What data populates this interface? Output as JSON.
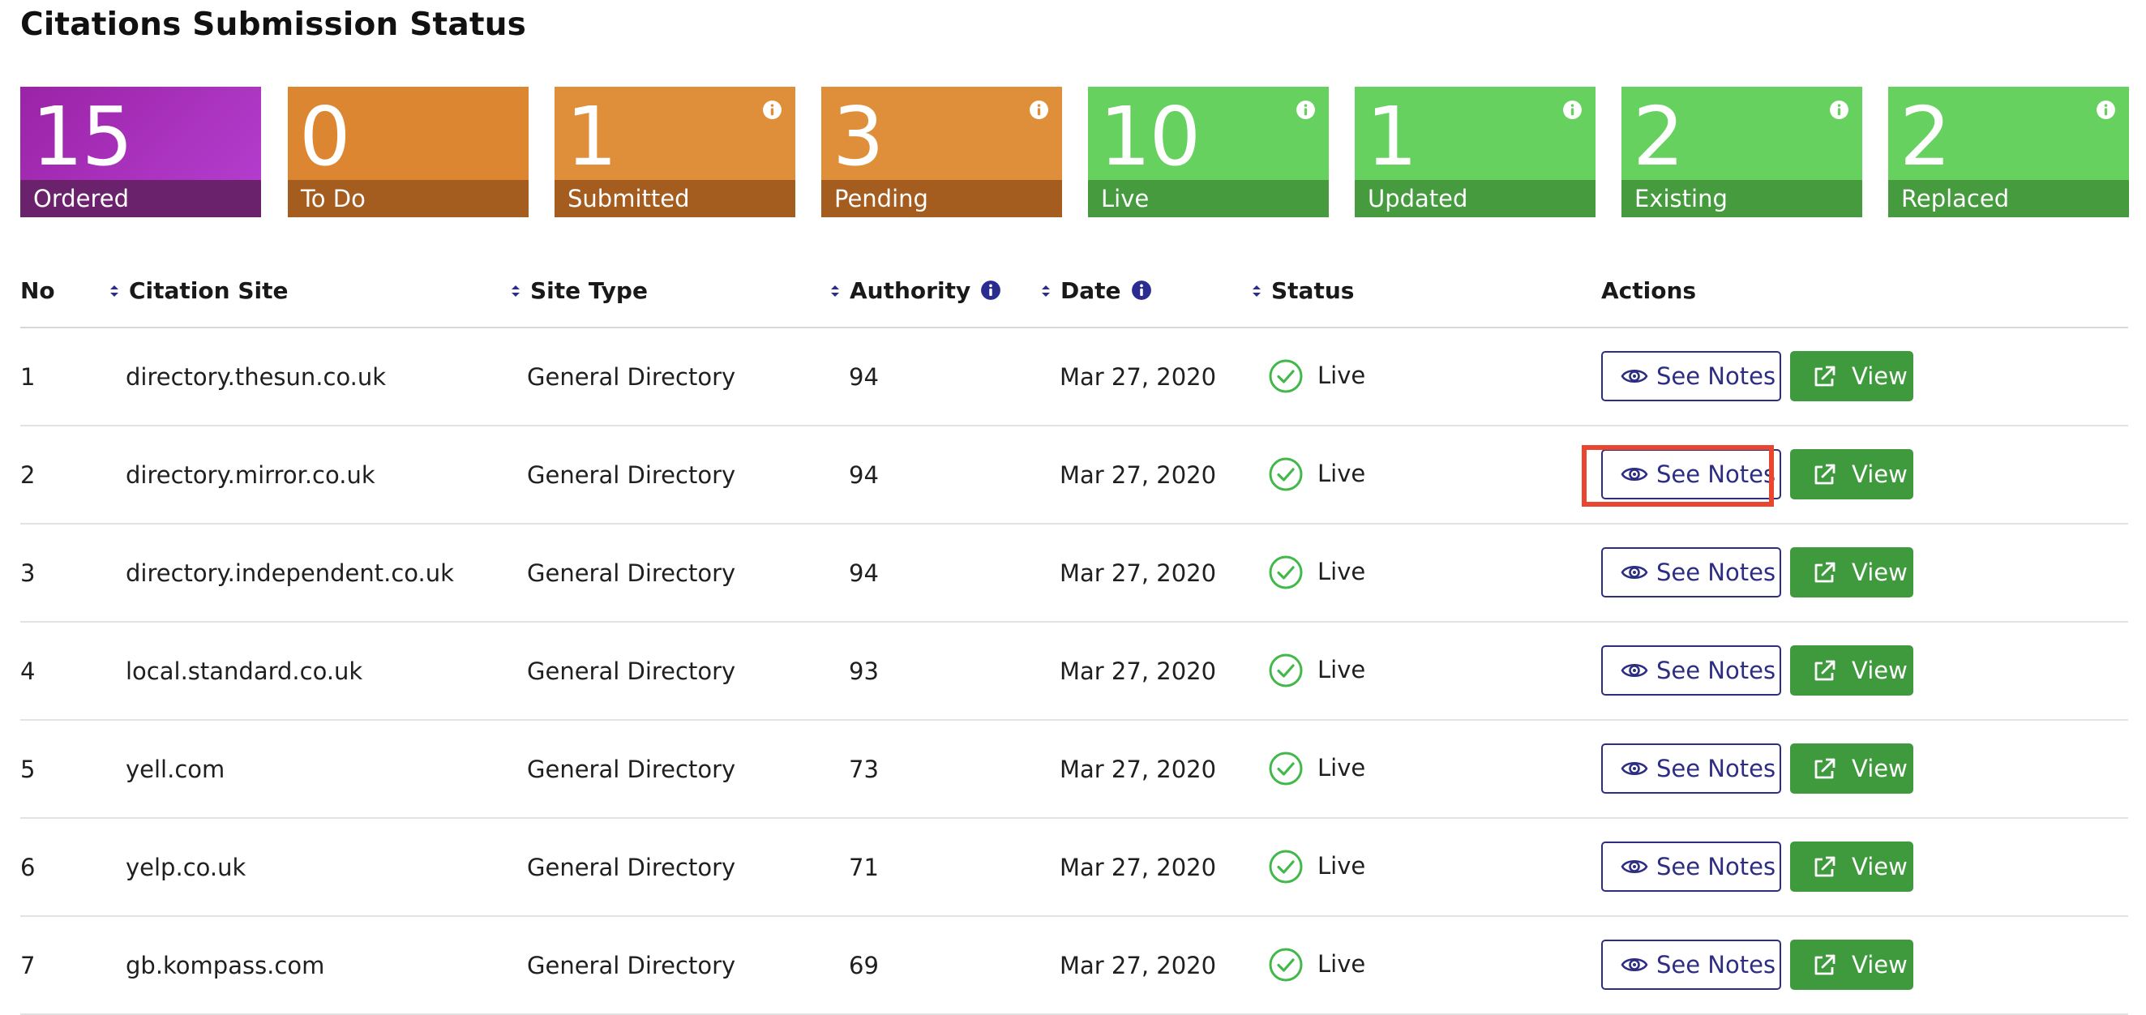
{
  "page": {
    "title": "Citations Submission Status"
  },
  "stats": [
    {
      "value": "15",
      "label": "Ordered",
      "color": "purple",
      "has_info": false
    },
    {
      "value": "0",
      "label": "To Do",
      "color": "orange",
      "has_info": false
    },
    {
      "value": "1",
      "label": "Submitted",
      "color": "orange",
      "has_info": true
    },
    {
      "value": "3",
      "label": "Pending",
      "color": "orange",
      "has_info": true
    },
    {
      "value": "10",
      "label": "Live",
      "color": "green",
      "has_info": true
    },
    {
      "value": "1",
      "label": "Updated",
      "color": "green",
      "has_info": true
    },
    {
      "value": "2",
      "label": "Existing",
      "color": "green",
      "has_info": true
    },
    {
      "value": "2",
      "label": "Replaced",
      "color": "green",
      "has_info": true
    }
  ],
  "table": {
    "headers": {
      "no": "No",
      "site": "Citation Site",
      "type": "Site Type",
      "authority": "Authority",
      "date": "Date",
      "status": "Status",
      "actions": "Actions"
    },
    "rows": [
      {
        "no": "1",
        "site": "directory.thesun.co.uk",
        "type": "General Directory",
        "authority": "94",
        "date": "Mar 27, 2020",
        "status": "Live"
      },
      {
        "no": "2",
        "site": "directory.mirror.co.uk",
        "type": "General Directory",
        "authority": "94",
        "date": "Mar 27, 2020",
        "status": "Live"
      },
      {
        "no": "3",
        "site": "directory.independent.co.uk",
        "type": "General Directory",
        "authority": "94",
        "date": "Mar 27, 2020",
        "status": "Live"
      },
      {
        "no": "4",
        "site": "local.standard.co.uk",
        "type": "General Directory",
        "authority": "93",
        "date": "Mar 27, 2020",
        "status": "Live"
      },
      {
        "no": "5",
        "site": "yell.com",
        "type": "General Directory",
        "authority": "73",
        "date": "Mar 27, 2020",
        "status": "Live"
      },
      {
        "no": "6",
        "site": "yelp.co.uk",
        "type": "General Directory",
        "authority": "71",
        "date": "Mar 27, 2020",
        "status": "Live"
      },
      {
        "no": "7",
        "site": "gb.kompass.com",
        "type": "General Directory",
        "authority": "69",
        "date": "Mar 27, 2020",
        "status": "Live"
      }
    ],
    "actions": {
      "notes_label": "See Notes",
      "view_label": "View"
    }
  },
  "colors": {
    "purple": "#9b23a7",
    "orange": "#dd8631",
    "green": "#66d15f",
    "live_check": "#43b84a",
    "notes_border": "#2d2d84",
    "view_button": "#3f9a3d",
    "highlight": "#e8462f"
  },
  "icons": {
    "stat_info": "info-icon",
    "sort": "sort-icon",
    "status_live": "check-circle-icon",
    "notes": "eye-icon",
    "view": "external-link-icon"
  }
}
